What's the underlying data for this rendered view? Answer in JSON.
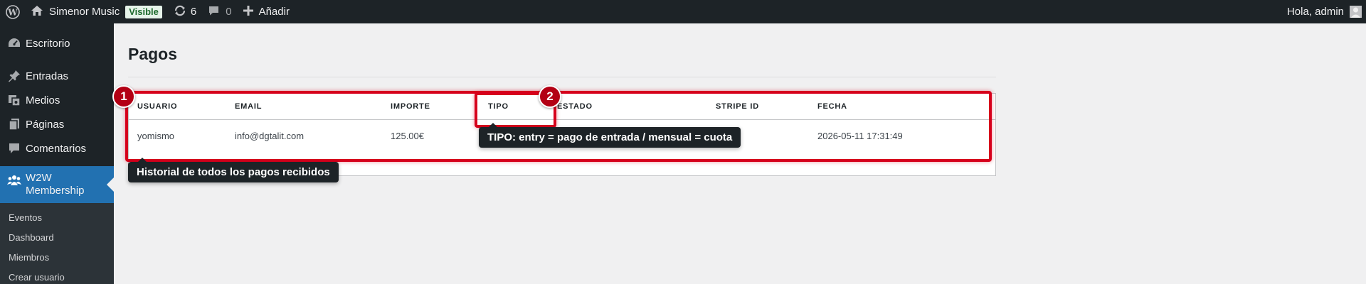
{
  "adminbar": {
    "site_name": "Simenor Music",
    "visible_badge": "Visible",
    "updates_count": "6",
    "comments_count": "0",
    "add_new": "Añadir",
    "greeting": "Hola, admin"
  },
  "sidebar": {
    "items": [
      {
        "label": "Escritorio",
        "icon": "dashboard-icon"
      },
      {
        "label": "Entradas",
        "icon": "pin-icon"
      },
      {
        "label": "Medios",
        "icon": "media-icon"
      },
      {
        "label": "Páginas",
        "icon": "pages-icon"
      },
      {
        "label": "Comentarios",
        "icon": "comment-icon"
      }
    ],
    "current": {
      "label_line1": "W2W",
      "label_line2": "Membership",
      "icon": "groups-icon"
    },
    "submenu": [
      "Eventos",
      "Dashboard",
      "Miembros",
      "Crear usuario"
    ]
  },
  "page": {
    "title": "Pagos"
  },
  "table": {
    "columns": [
      "USUARIO",
      "EMAIL",
      "IMPORTE",
      "TIPO",
      "ESTADO",
      "STRIPE ID",
      "FECHA"
    ],
    "rows": [
      {
        "usuario": "yomismo",
        "email": "info@dgtalit.com",
        "importe": "125.00€",
        "tipo": "",
        "estado": "",
        "stripe_id": "",
        "fecha": "2026-05-11 17:31:49"
      }
    ]
  },
  "annotations": {
    "marker1": "1",
    "marker2": "2",
    "tooltip_tipo": "TIPO: entry = pago de entrada / mensual = cuota",
    "tooltip_historial": "Historial de todos los pagos recibidos"
  },
  "colors": {
    "adminbar_bg": "#1d2327",
    "accent": "#2271b1",
    "highlight": "#d6001c"
  }
}
